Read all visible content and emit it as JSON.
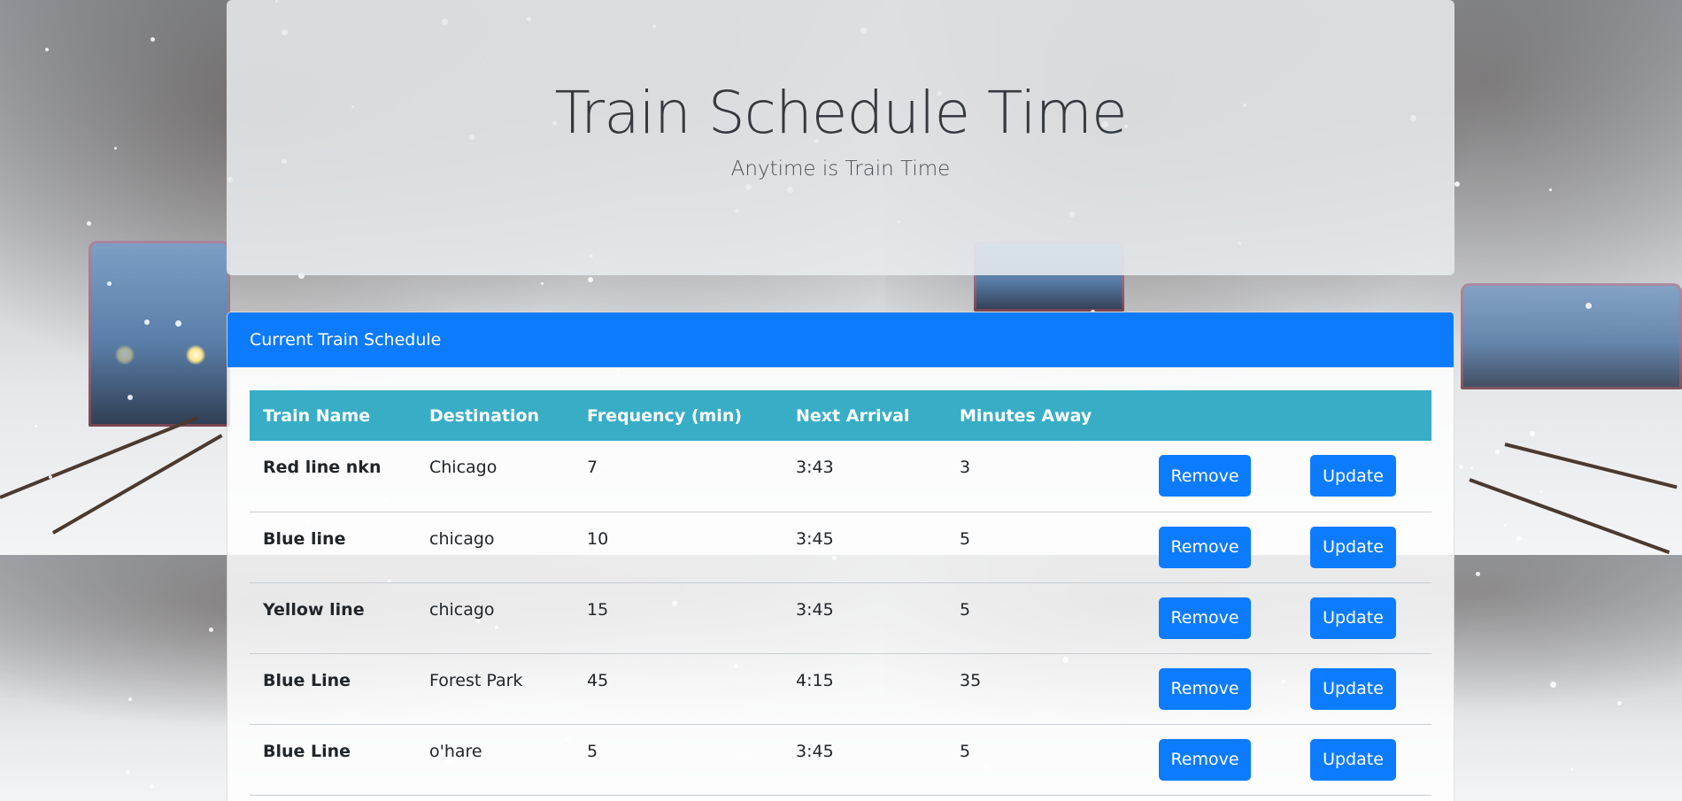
{
  "header": {
    "title": "Train Schedule Time",
    "subtitle": "Anytime is Train Time"
  },
  "schedule": {
    "card_title": "Current Train Schedule",
    "columns": [
      "Train Name",
      "Destination",
      "Frequency (min)",
      "Next Arrival",
      "Minutes Away"
    ],
    "rows": [
      {
        "name": "Red line nkn",
        "destination": "Chicago",
        "frequency": "7",
        "next_arrival": "3:43",
        "minutes_away": "3",
        "remove_label": "Remove",
        "update_label": "Update"
      },
      {
        "name": "Blue line",
        "destination": "chicago",
        "frequency": "10",
        "next_arrival": "3:45",
        "minutes_away": "5",
        "remove_label": "Remove",
        "update_label": "Update"
      },
      {
        "name": "Yellow line",
        "destination": "chicago",
        "frequency": "15",
        "next_arrival": "3:45",
        "minutes_away": "5",
        "remove_label": "Remove",
        "update_label": "Update"
      },
      {
        "name": "Blue Line",
        "destination": "Forest Park",
        "frequency": "45",
        "next_arrival": "4:15",
        "minutes_away": "35",
        "remove_label": "Remove",
        "update_label": "Update"
      },
      {
        "name": "Blue Line",
        "destination": "o'hare",
        "frequency": "5",
        "next_arrival": "3:45",
        "minutes_away": "5",
        "remove_label": "Remove",
        "update_label": "Update"
      }
    ]
  },
  "colors": {
    "primary": "#0d7bfe",
    "table_header": "#38adc6",
    "jumbotron": "#e9ecef"
  }
}
